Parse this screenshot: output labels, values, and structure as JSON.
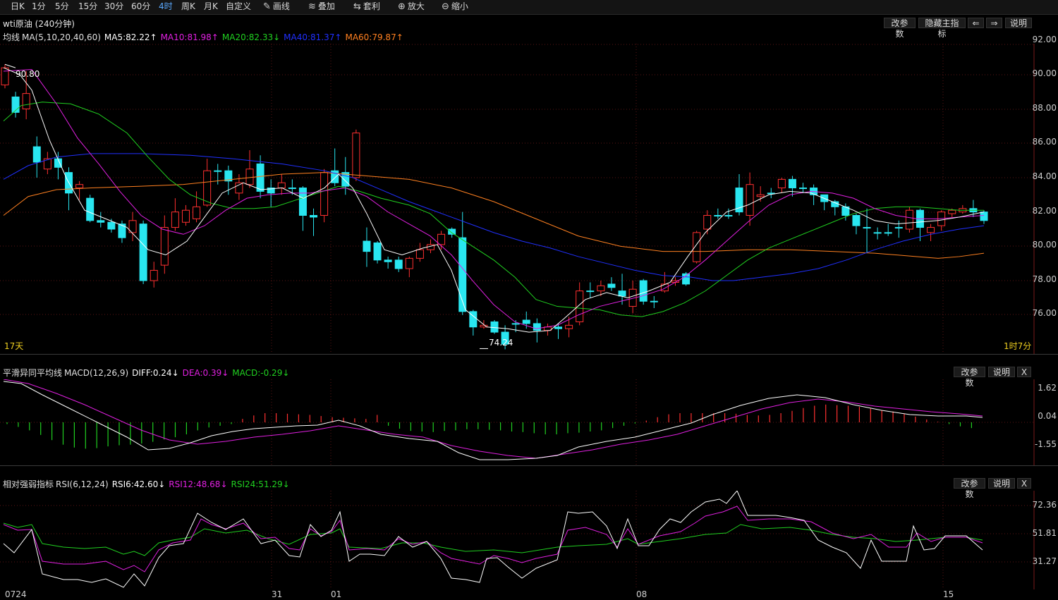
{
  "toolbar": {
    "periods": [
      "日K",
      "1分",
      "5分",
      "15分",
      "30分",
      "60分",
      "4时",
      "周K",
      "月K",
      "自定义"
    ],
    "active_period": "4时",
    "tools": [
      {
        "label": "画线",
        "icon": "pencil-icon",
        "glyph": "✎"
      },
      {
        "label": "叠加",
        "icon": "stack-icon",
        "glyph": "≋"
      },
      {
        "label": "套利",
        "icon": "arbitrage-icon",
        "glyph": "⇆"
      },
      {
        "label": "放大",
        "icon": "zoom-in-icon",
        "glyph": "⊕"
      },
      {
        "label": "缩小",
        "icon": "zoom-out-icon",
        "glyph": "⊖"
      }
    ]
  },
  "main": {
    "title": "wti原油 (240分钟)",
    "buttons": {
      "params": "改参数",
      "hide": "隐藏主指标",
      "prev": "⇐",
      "next": "⇒",
      "help": "说明"
    },
    "indicator": {
      "name": "均线",
      "params": "MA(5,10,20,40,60)",
      "ma5": "MA5:82.22↑",
      "ma10": "MA10:81.98↑",
      "ma20": "MA20:82.33↓",
      "ma40": "MA40:81.37↑",
      "ma60": "MA60:79.87↑"
    },
    "y_labels": [
      "92.00",
      "90.00",
      "88.00",
      "86.00",
      "84.00",
      "82.00",
      "80.00",
      "78.00",
      "76.00"
    ],
    "high_label": "90.80",
    "low_label": "74.24",
    "span_left": "17天",
    "span_right": "1时7分"
  },
  "macd": {
    "name": "平滑异同平均线",
    "params": "MACD(12,26,9)",
    "diff": "DIFF:0.24↓",
    "dea": "DEA:0.39↓",
    "macd": "MACD:-0.29↓",
    "buttons": {
      "params": "改参数",
      "help": "说明",
      "close": "X"
    },
    "y_labels": [
      "1.62",
      "0.04",
      "-1.55"
    ]
  },
  "rsi": {
    "name": "相对强弱指标",
    "params": "RSI(6,12,24)",
    "rsi6": "RSI6:42.60↓",
    "rsi12": "RSI12:48.68↓",
    "rsi24": "RSI24:51.29↓",
    "buttons": {
      "params": "改参数",
      "help": "说明",
      "close": "X"
    },
    "y_labels": [
      "72.36",
      "51.81",
      "31.27"
    ]
  },
  "x_labels": [
    "0724",
    "31",
    "01",
    "08",
    "15"
  ],
  "colors": {
    "up": "#ff3030",
    "down": "#29e6f0",
    "ma5": "#ffffff",
    "ma10": "#e020e0",
    "ma20": "#20d020",
    "ma40": "#2030ff",
    "ma60": "#ff8020",
    "grid": "#3a1010"
  }
}
